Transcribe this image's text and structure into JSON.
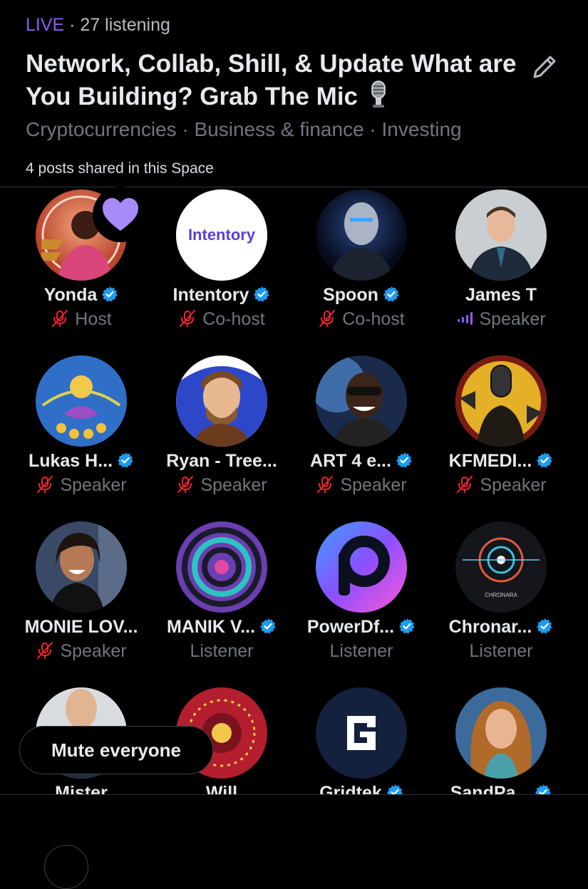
{
  "header": {
    "live_label": "LIVE",
    "separator": " · ",
    "listening": "27 listening",
    "title": "Network, Collab, Shill, & Update What are You Building? Grab The Mic",
    "topics": "Cryptocurrencies · Business & finance · Investing",
    "posts_shared": "4 posts shared in this Space"
  },
  "participants": [
    {
      "name": "Yonda",
      "role": "Host",
      "verified": true,
      "state": "muted"
    },
    {
      "name": "Intentory",
      "role": "Co-host",
      "verified": true,
      "state": "muted",
      "avatar_text": "Intentory"
    },
    {
      "name": "Spoon",
      "role": "Co-host",
      "verified": true,
      "state": "muted"
    },
    {
      "name": "James T",
      "role": "Speaker",
      "verified": false,
      "state": "speaking"
    },
    {
      "name": "Lukas H...",
      "role": "Speaker",
      "verified": true,
      "state": "muted"
    },
    {
      "name": "Ryan - Tree...",
      "role": "Speaker",
      "verified": false,
      "state": "muted"
    },
    {
      "name": "ART 4 e...",
      "role": "Speaker",
      "verified": true,
      "state": "muted"
    },
    {
      "name": "KFMEDI...",
      "role": "Speaker",
      "verified": true,
      "state": "muted"
    },
    {
      "name": "MONIE LOV...",
      "role": "Speaker",
      "verified": false,
      "state": "muted"
    },
    {
      "name": "MANIK V...",
      "role": "Listener",
      "verified": true,
      "state": "listener"
    },
    {
      "name": "PowerDf...",
      "role": "Listener",
      "verified": true,
      "state": "listener"
    },
    {
      "name": "Chronar...",
      "role": "Listener",
      "verified": true,
      "state": "listener",
      "avatar_text": "CHRONARA"
    },
    {
      "name": "Mister",
      "role": "",
      "verified": false,
      "state": "listener"
    },
    {
      "name": "Will",
      "role": "",
      "verified": false,
      "state": "listener"
    },
    {
      "name": "Gridtek",
      "role": "",
      "verified": true,
      "state": "listener"
    },
    {
      "name": "SandPa...",
      "role": "",
      "verified": true,
      "state": "listener"
    }
  ],
  "mute_everyone_label": "Mute everyone",
  "colors": {
    "live": "#8b5cf6",
    "muted_icon": "#f4212e",
    "verified": "#1d9bf0",
    "speaking": "#8b5cf6",
    "heart": "#a78bfa"
  },
  "icons": {
    "edit": "pencil-icon",
    "muted": "mic-muted-icon",
    "speaking": "speaking-bars-icon",
    "verified": "verified-badge-icon",
    "reaction": "heart-icon"
  }
}
